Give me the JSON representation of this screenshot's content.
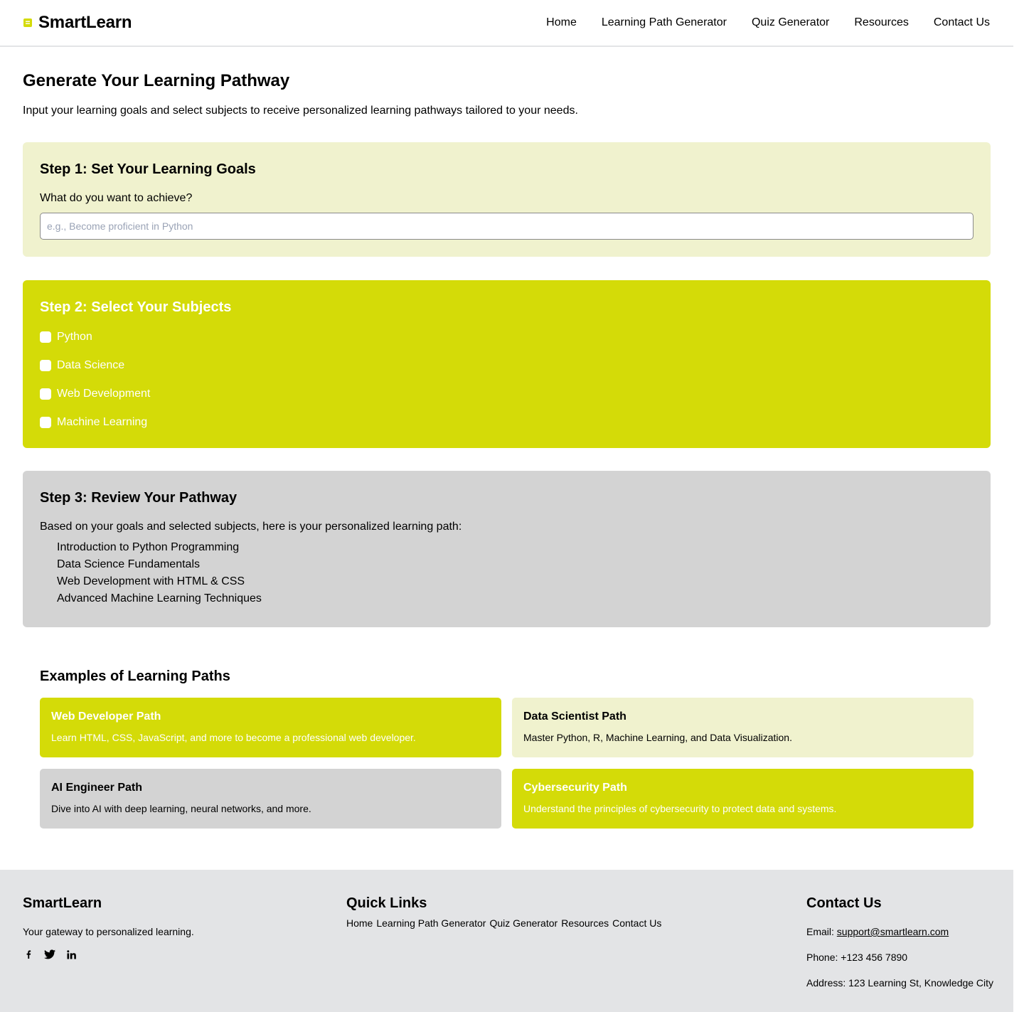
{
  "header": {
    "brand": "SmartLearn",
    "brand_icon": "book-icon",
    "nav": [
      "Home",
      "Learning Path Generator",
      "Quiz Generator",
      "Resources",
      "Contact Us"
    ]
  },
  "main": {
    "title": "Generate Your Learning Pathway",
    "subtitle": "Input your learning goals and select subjects to receive personalized learning pathways tailored to your needs."
  },
  "step1": {
    "title": "Step 1: Set Your Learning Goals",
    "question": "What do you want to achieve?",
    "input_value": "",
    "input_placeholder": "e.g., Become proficient in Python"
  },
  "step2": {
    "title": "Step 2: Select Your Subjects",
    "subjects": [
      {
        "label": "Python",
        "checked": false
      },
      {
        "label": "Data Science",
        "checked": false
      },
      {
        "label": "Web Development",
        "checked": false
      },
      {
        "label": "Machine Learning",
        "checked": false
      }
    ]
  },
  "step3": {
    "title": "Step 3: Review Your Pathway",
    "intro": "Based on your goals and selected subjects, here is your personalized learning path:",
    "items": [
      "Introduction to Python Programming",
      "Data Science Fundamentals",
      "Web Development with HTML & CSS",
      "Advanced Machine Learning Techniques"
    ]
  },
  "examples": {
    "title": "Examples of Learning Paths",
    "cards": [
      {
        "title": "Web Developer Path",
        "desc": "Learn HTML, CSS, JavaScript, and more to become a professional web developer.",
        "color": "#d4db08"
      },
      {
        "title": "Data Scientist Path",
        "desc": "Master Python, R, Machine Learning, and Data Visualization.",
        "color": "#f0f2ce"
      },
      {
        "title": "AI Engineer Path",
        "desc": "Dive into AI with deep learning, neural networks, and more.",
        "color": "#d3d3d3"
      },
      {
        "title": "Cybersecurity Path",
        "desc": "Understand the principles of cybersecurity to protect data and systems.",
        "color": "#d4db08"
      }
    ]
  },
  "footer": {
    "brand": "SmartLearn",
    "tagline": "Your gateway to personalized learning.",
    "socials": [
      "facebook-icon",
      "twitter-icon",
      "linkedin-icon"
    ],
    "quick_links_title": "Quick Links",
    "quick_links": [
      "Home",
      "Learning Path Generator",
      "Quiz Generator",
      "Resources",
      "Contact Us"
    ],
    "contact_title": "Contact Us",
    "email_label": "Email:",
    "email": "support@smartlearn.com",
    "phone": "Phone: +123 456 7890",
    "address": "Address: 123 Learning St, Knowledge City"
  },
  "colors": {
    "accent": "#d4db08",
    "accent_light": "#f0f2ce",
    "grey_panel": "#d3d3d3",
    "footer_bg": "#e3e4e6"
  }
}
